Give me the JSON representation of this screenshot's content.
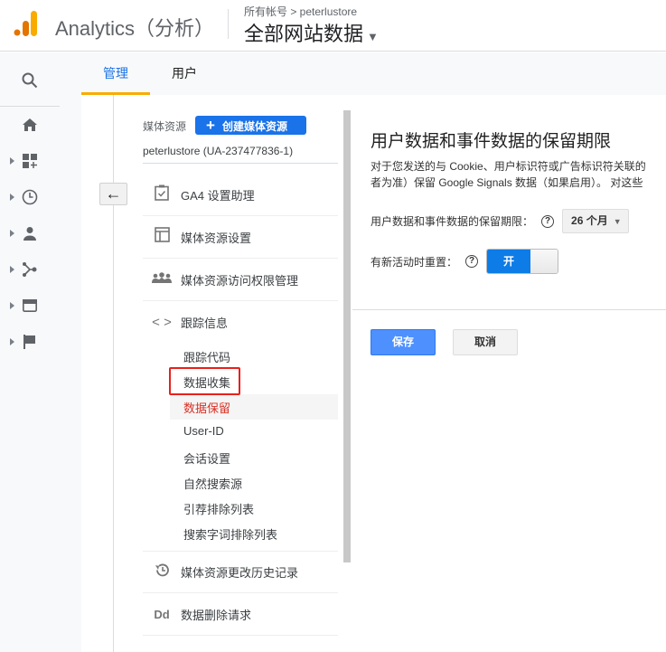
{
  "header": {
    "app_title": "Analytics（分析）",
    "breadcrumb": "所有帐号 > peterlustore",
    "view": "全部网站数据"
  },
  "colors": {
    "accent": "#1a73e8",
    "tab_underline": "#f9ab00",
    "highlight_box": "#e8201c"
  },
  "tabs": [
    {
      "label": "管理"
    },
    {
      "label": "用户"
    }
  ],
  "property": {
    "label": "媒体资源",
    "create_label": "创建媒体资源",
    "name": "peterlustore (UA-237477836-1)"
  },
  "menu": [
    {
      "label": "GA4 设置助理",
      "icon": "clipboard-check-icon"
    },
    {
      "label": "媒体资源设置",
      "icon": "layout-icon"
    },
    {
      "label": "媒体资源访问权限管理",
      "icon": "people-icon"
    },
    {
      "label": "跟踪信息",
      "icon": "code-icon"
    }
  ],
  "submenu": [
    "跟踪代码",
    "数据收集",
    "数据保留",
    "User-ID",
    "会话设置",
    "自然搜索源",
    "引荐排除列表",
    "搜索字词排除列表"
  ],
  "menu2": [
    {
      "label": "媒体资源更改历史记录",
      "icon": "history-icon"
    },
    {
      "label": "数据删除请求",
      "icon": "dd-icon",
      "icon_text": "Dd"
    }
  ],
  "panel": {
    "title": "用户数据和事件数据的保留期限",
    "desc1": "对于您发送的与 Cookie、用户标识符或广告标识符关联的",
    "desc2": "者为准）保留 Google Signals 数据（如果启用）。 对这些",
    "retention_label": "用户数据和事件数据的保留期限：",
    "retention_value": "26 个月",
    "reset_label": "有新活动时重置：",
    "reset_value": "开",
    "save": "保存",
    "cancel": "取消"
  }
}
